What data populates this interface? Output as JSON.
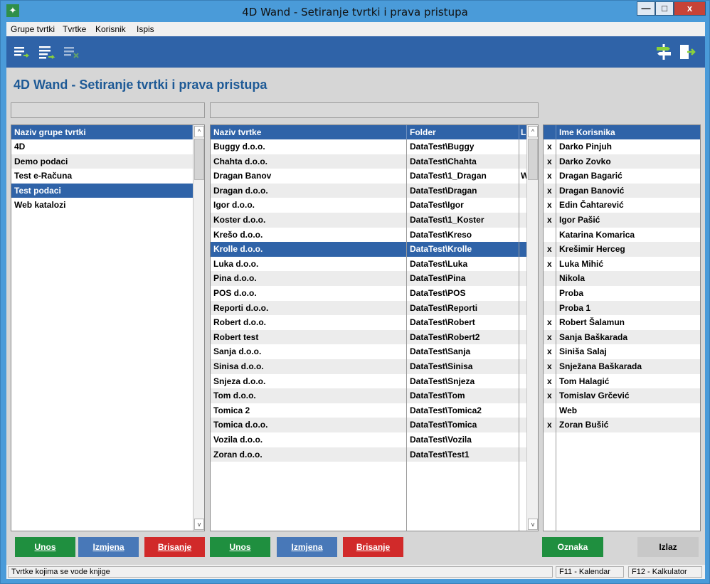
{
  "window": {
    "title": "4D Wand - Setiranje tvrtki i prava pristupa",
    "min_label": "—",
    "max_label": "□",
    "close_label": "x"
  },
  "menu": [
    "Grupe tvrtki",
    "Tvrtke",
    "Korisnik",
    "Ispis"
  ],
  "page_title": "4D Wand - Setiranje tvrtki i prava pristupa",
  "groups": {
    "header": "Naziv grupe tvrtki",
    "items": [
      "4D",
      "Demo podaci",
      "Test e-Računa",
      "Test podaci",
      "Web katalozi"
    ],
    "selected": "Test podaci"
  },
  "companies": {
    "headers": [
      "Naziv tvrtke",
      "Folder",
      "L"
    ],
    "rows": [
      [
        "Buggy d.o.o.",
        "DataTest\\Buggy",
        ""
      ],
      [
        "Chahta d.o.o.",
        "DataTest\\Chahta",
        ""
      ],
      [
        "Dragan Banov",
        "DataTest\\1_Dragan",
        "W"
      ],
      [
        "Dragan d.o.o.",
        "DataTest\\Dragan",
        ""
      ],
      [
        "Igor d.o.o.",
        "DataTest\\Igor",
        ""
      ],
      [
        "Koster d.o.o.",
        "DataTest\\1_Koster",
        ""
      ],
      [
        "Krešo d.o.o.",
        "DataTest\\Kreso",
        ""
      ],
      [
        "Krolle d.o.o.",
        "DataTest\\Krolle",
        ""
      ],
      [
        "Luka d.o.o.",
        "DataTest\\Luka",
        ""
      ],
      [
        "Pina d.o.o.",
        "DataTest\\Pina",
        ""
      ],
      [
        "POS d.o.o.",
        "DataTest\\POS",
        ""
      ],
      [
        "Reporti d.o.o.",
        "DataTest\\Reporti",
        ""
      ],
      [
        "Robert d.o.o.",
        "DataTest\\Robert",
        ""
      ],
      [
        "Robert test",
        "DataTest\\Robert2",
        ""
      ],
      [
        "Sanja d.o.o.",
        "DataTest\\Sanja",
        ""
      ],
      [
        "Sinisa d.o.o.",
        "DataTest\\Sinisa",
        ""
      ],
      [
        "Snjeza d.o.o.",
        "DataTest\\Snjeza",
        ""
      ],
      [
        "Tom d.o.o.",
        "DataTest\\Tom",
        ""
      ],
      [
        "Tomica 2",
        "DataTest\\Tomica2",
        ""
      ],
      [
        "Tomica d.o.o.",
        "DataTest\\Tomica",
        ""
      ],
      [
        "Vozila d.o.o.",
        "DataTest\\Vozila",
        ""
      ],
      [
        "Zoran d.o.o.",
        "DataTest\\Test1",
        ""
      ]
    ],
    "selected": "Krolle d.o.o."
  },
  "users": {
    "header": "Ime Korisnika",
    "rows": [
      [
        "x",
        "Darko Pinjuh"
      ],
      [
        "x",
        "Darko Zovko"
      ],
      [
        "x",
        "Dragan Bagarić"
      ],
      [
        "x",
        "Dragan Banović"
      ],
      [
        "x",
        "Edin Čahtarević"
      ],
      [
        "x",
        "Igor Pašić"
      ],
      [
        "",
        "Katarina Komarica"
      ],
      [
        "x",
        "Krešimir Herceg"
      ],
      [
        "x",
        "Luka Mihić"
      ],
      [
        "",
        "Nikola"
      ],
      [
        "",
        "Proba"
      ],
      [
        "",
        "Proba 1"
      ],
      [
        "x",
        "Robert Šalamun"
      ],
      [
        "x",
        "Sanja Baškarada"
      ],
      [
        "x",
        "Siniša Salaj"
      ],
      [
        "x",
        "Snježana Baškarada"
      ],
      [
        "x",
        "Tom Halagić"
      ],
      [
        "x",
        "Tomislav Grčević"
      ],
      [
        "",
        "Web"
      ],
      [
        "x",
        "Zoran Bušić"
      ]
    ]
  },
  "scroll": {
    "up": "^",
    "down": "v"
  },
  "buttons": {
    "group_add": "Unos",
    "group_edit": "Izmjena",
    "group_delete": "Brisanje",
    "company_add": "Unos",
    "company_edit": "Izmjena",
    "company_delete": "Brisanje",
    "mark": "Oznaka",
    "exit": "Izlaz"
  },
  "status": {
    "message": "Tvrtke kojima se vode knjige",
    "f11": "F11 - Kalendar",
    "f12": "F12 - Kalkulator"
  },
  "colors": {
    "accent": "#2f63a8",
    "title": "#1e5a96",
    "green": "#1f8f3f",
    "red": "#d12a2a"
  },
  "icons": [
    "app-icon",
    "list-add-icon",
    "list-edit-icon",
    "list-delete-icon",
    "signpost-icon",
    "exit-door-icon"
  ]
}
